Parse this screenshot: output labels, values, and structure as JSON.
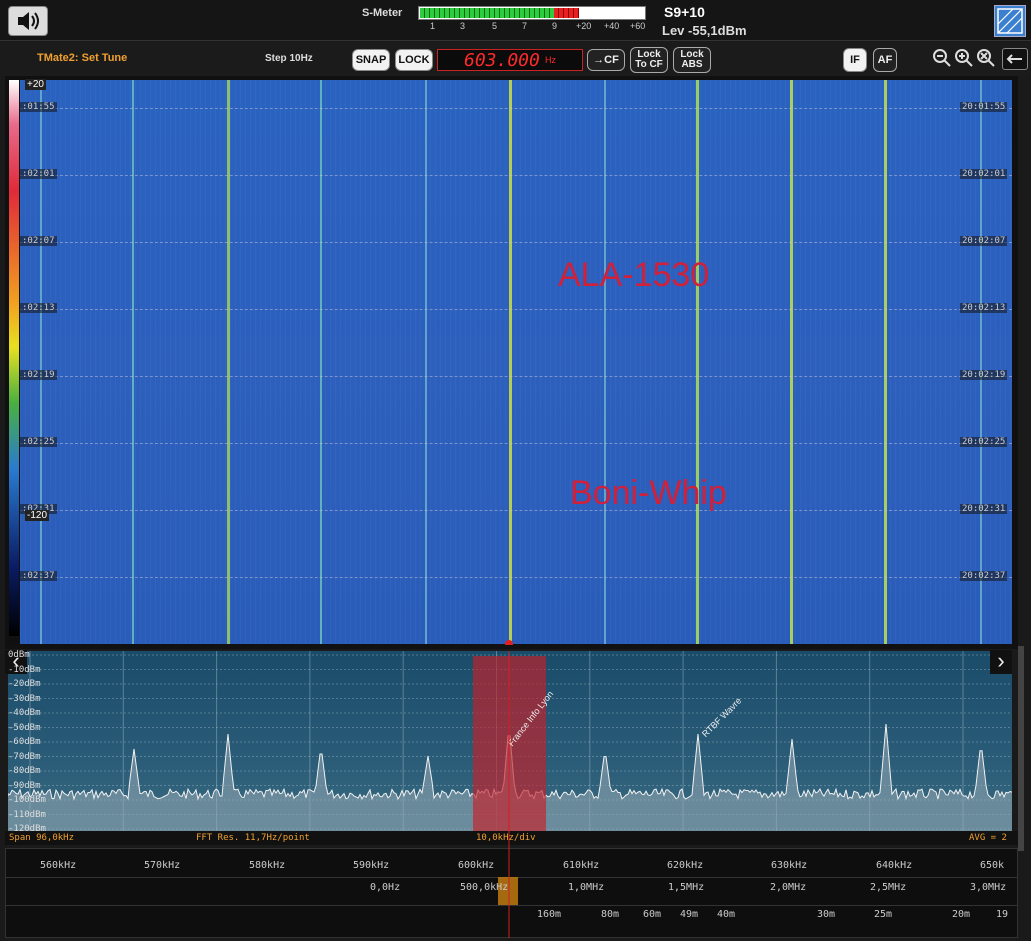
{
  "topbar": {
    "speaker_icon": "speaker-icon",
    "smeter_label": "S-Meter",
    "smeter_ticks": [
      "1",
      "3",
      "5",
      "7",
      "9",
      "+20",
      "+40",
      "+60"
    ],
    "smeter_green_fraction": 0.6,
    "smeter_red_fraction": 0.11,
    "s_reading": "S9+10",
    "level_reading": "Lev -55,1dBm",
    "corner_icon": "grid-icon"
  },
  "toolbar": {
    "tmate_label": "TMate2: Set Tune",
    "step_label": "Step 10Hz",
    "snap_label": "SNAP",
    "lock_label": "LOCK",
    "frequency": "603.000",
    "frequency_unit": "Hz",
    "to_cf_label": "→CF",
    "lock_to_cf_label": "Lock\nTo CF",
    "lock_abs_label": "Lock\nABS",
    "if_label": "IF",
    "af_label": "AF",
    "zoom_out_icon": "zoom-out-icon",
    "zoom_in_icon": "zoom-in-icon",
    "zoom_reset_icon": "zoom-reset-icon",
    "back_icon": "back-arrow-icon"
  },
  "waterfall": {
    "scale_top": "+20",
    "scale_bottom": "-120",
    "time_labels_left": [
      ":01:55",
      ":02:01",
      ":02:07",
      ":02:13",
      ":02:19",
      ":02:25",
      ":02:31",
      ":02:37"
    ],
    "time_labels_right": [
      "20:01:55",
      "20:02:01",
      "20:02:07",
      "20:02:13",
      "20:02:19",
      "20:02:25",
      "20:02:31",
      "20:02:37"
    ],
    "annotation_1": "ALA-1530",
    "annotation_2": "Boni-Whip"
  },
  "spectrum": {
    "db_labels": [
      "0dBm",
      "-10dBm",
      "-20dBm",
      "-30dBm",
      "-40dBm",
      "-50dBm",
      "-60dBm",
      "-70dBm",
      "-80dBm",
      "-90dBm",
      "-100dBm",
      "-110dBm",
      "-120dBm"
    ],
    "station_1": "France Info Lyon",
    "station_2": "RTBF Wavre",
    "span": "Span 96,0kHz",
    "fft_res": "FFT Res. 11,7Hz/point",
    "div": "10,0kHz/div",
    "avg": "AVG = 2"
  },
  "scales": {
    "freq_labels": [
      "560kHz",
      "570kHz",
      "580kHz",
      "590kHz",
      "600kHz",
      "610kHz",
      "620kHz",
      "630kHz",
      "640kHz",
      "650k"
    ],
    "mhz_labels": [
      "0,0Hz",
      "500,0kHz",
      "1,0MHz",
      "1,5MHz",
      "2,0MHz",
      "2,5MHz",
      "3,0MHz"
    ],
    "meter_labels": [
      "160m",
      "80m",
      "60m",
      "49m",
      "40m",
      "30m",
      "25m",
      "20m",
      "19"
    ]
  }
}
